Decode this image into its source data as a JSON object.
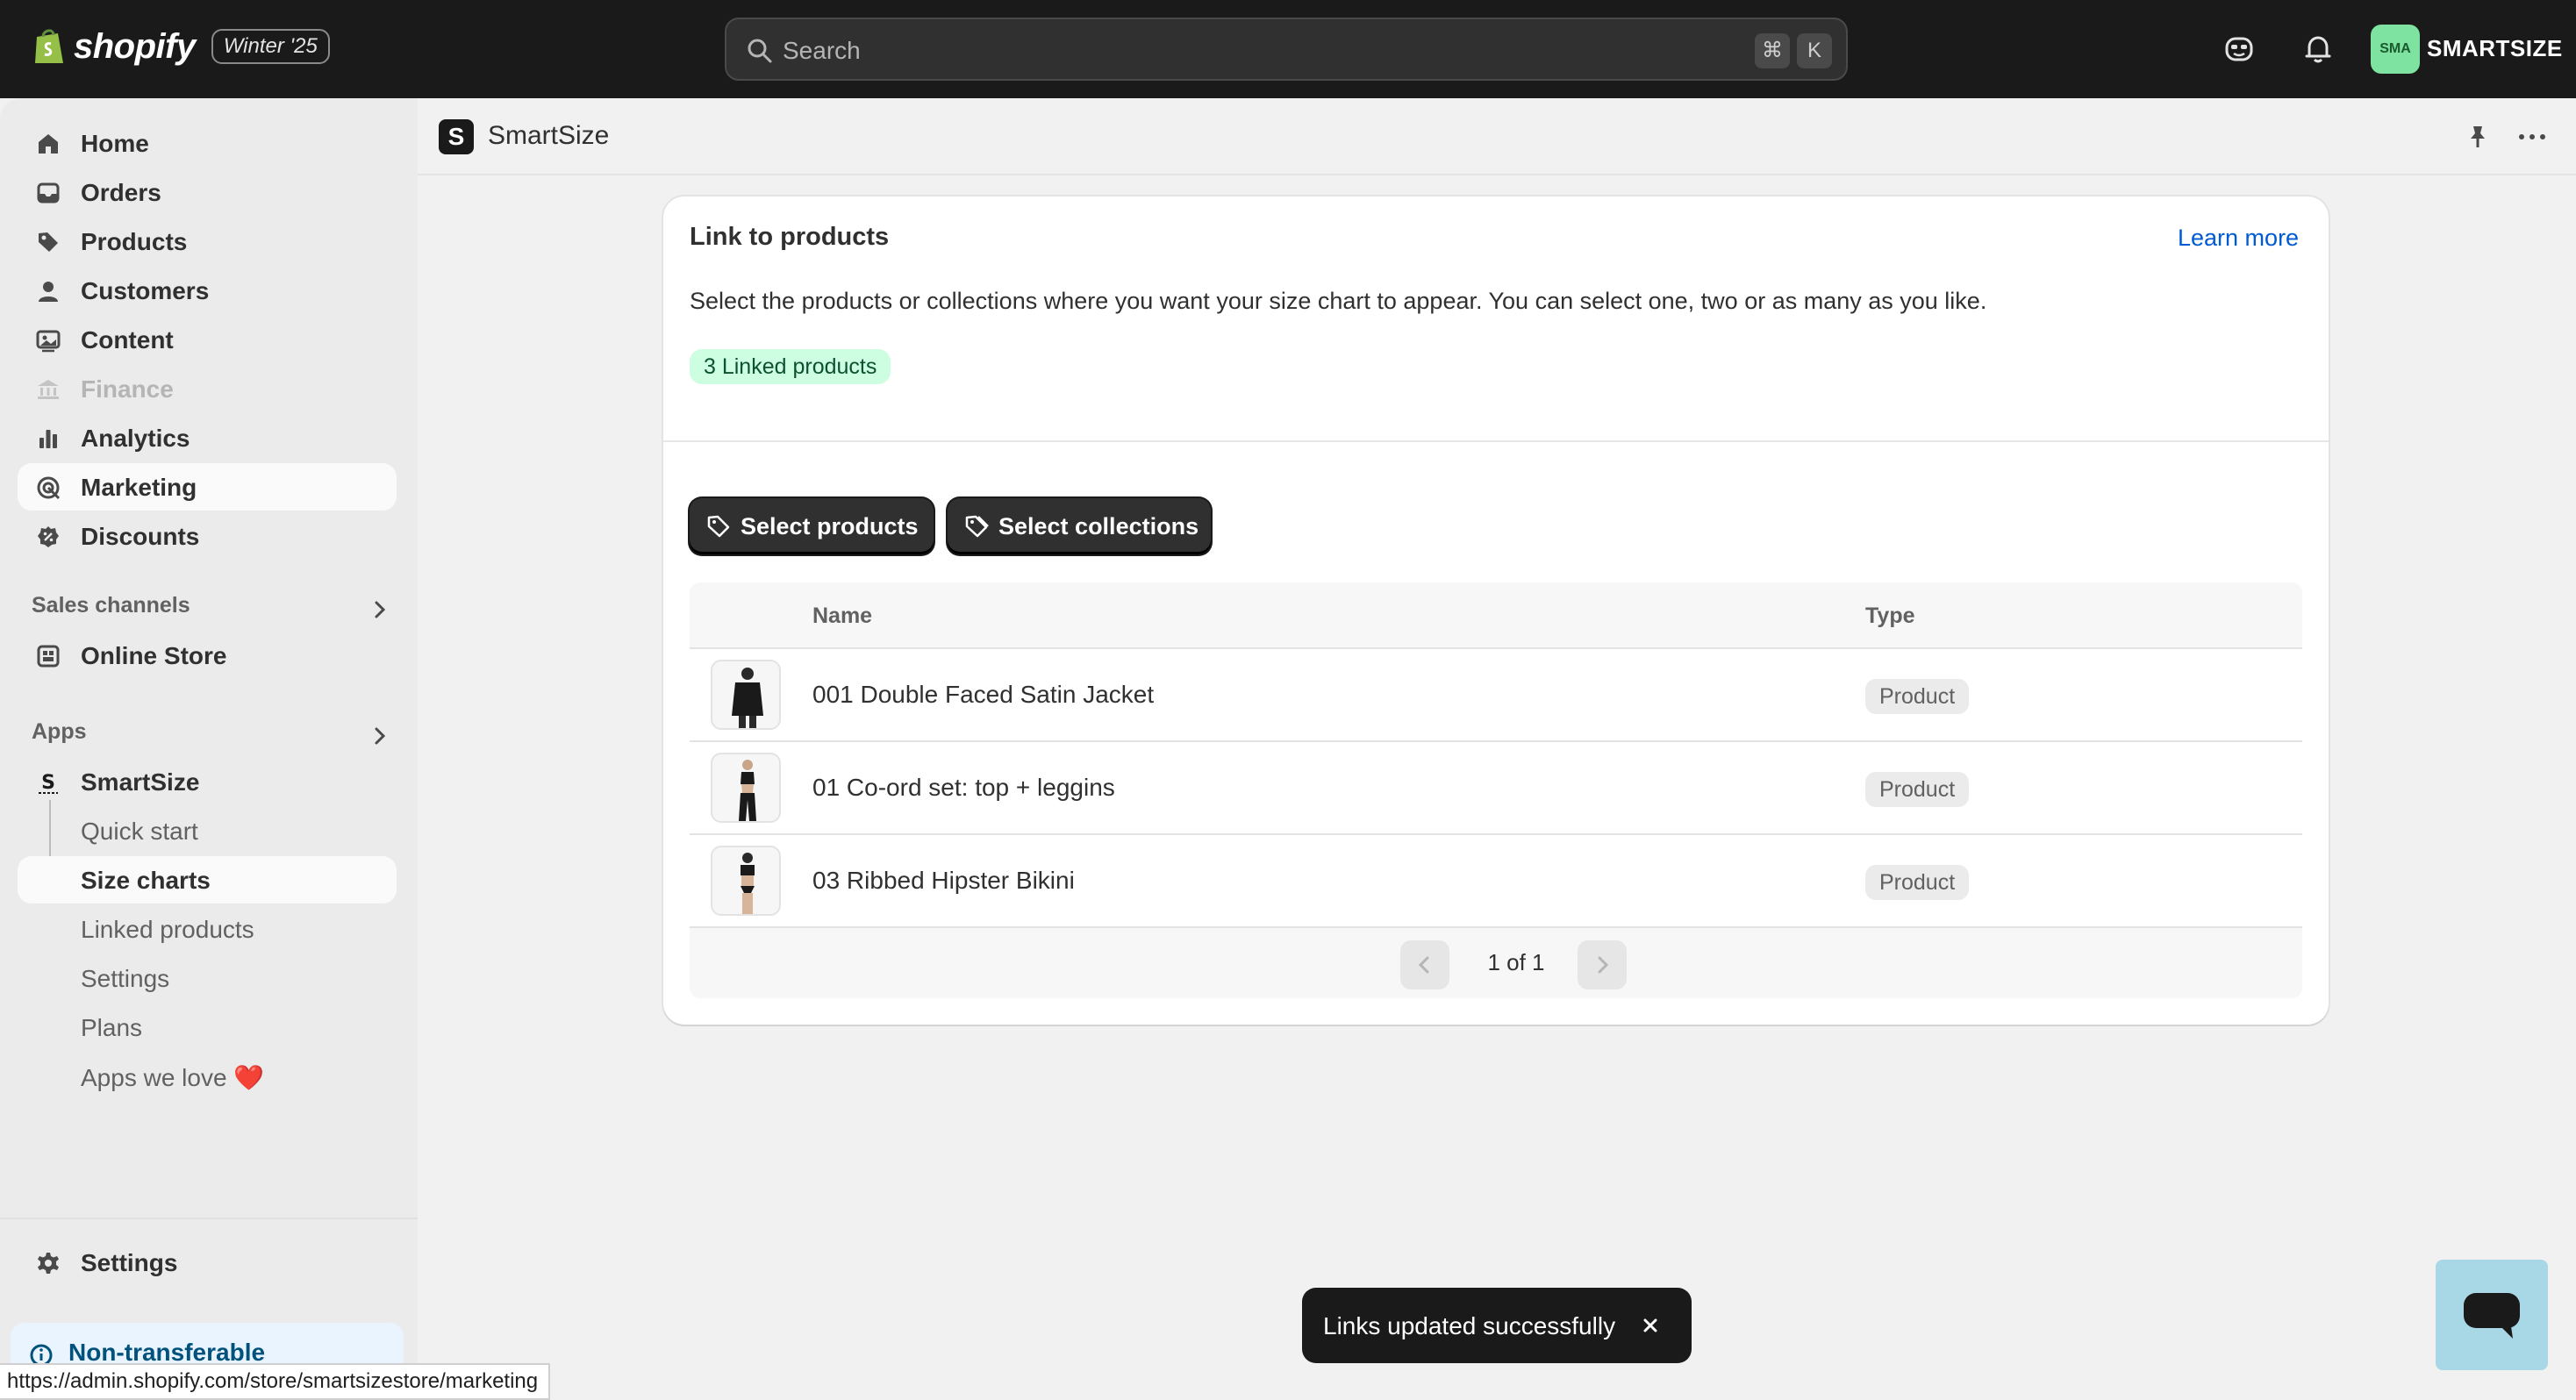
{
  "topbar": {
    "brand": "shopify",
    "edition": "Winter '25",
    "search_placeholder": "Search",
    "shortcut_cmd": "⌘",
    "shortcut_key": "K",
    "avatar_initials": "SMA",
    "store_name": "SMARTSIZE"
  },
  "sidebar": {
    "main": [
      {
        "label": "Home",
        "icon": "home-icon"
      },
      {
        "label": "Orders",
        "icon": "inbox-icon"
      },
      {
        "label": "Products",
        "icon": "tag-icon"
      },
      {
        "label": "Customers",
        "icon": "person-icon"
      },
      {
        "label": "Content",
        "icon": "content-icon"
      },
      {
        "label": "Finance",
        "icon": "bank-icon"
      },
      {
        "label": "Analytics",
        "icon": "bar-chart-icon"
      },
      {
        "label": "Marketing",
        "icon": "target-icon"
      },
      {
        "label": "Discounts",
        "icon": "discount-icon"
      }
    ],
    "sales_channels_label": "Sales channels",
    "online_store_label": "Online Store",
    "apps_label": "Apps",
    "app_name": "SmartSize",
    "app_sub": [
      "Quick start",
      "Size charts",
      "Linked products",
      "Settings",
      "Plans",
      "Apps we love ❤️"
    ],
    "settings_label": "Settings",
    "nontransferable_label": "Non-transferable"
  },
  "status_url": "https://admin.shopify.com/store/smartsizestore/marketing",
  "app_header": {
    "logo_letter": "S",
    "title": "SmartSize"
  },
  "card": {
    "title": "Link to products",
    "learn_more": "Learn more",
    "description": "Select the products or collections where you want your size chart to appear. You can select one, two or as many as you like.",
    "badge": "3 Linked products",
    "select_products": "Select products",
    "select_collections": "Select collections",
    "columns": {
      "name": "Name",
      "type": "Type"
    },
    "rows": [
      {
        "name": "001 Double Faced Satin Jacket",
        "type": "Product"
      },
      {
        "name": "01 Co-ord set: top + leggins",
        "type": "Product"
      },
      {
        "name": "03 Ribbed Hipster Bikini",
        "type": "Product"
      }
    ],
    "pagination": "1 of 1"
  },
  "toast": {
    "message": "Links updated successfully"
  },
  "colors": {
    "topbar": "#1a1a1a",
    "accent_link": "#005bd3",
    "badge_bg": "#cdfee1",
    "avatar_bg": "#7ee2a0"
  }
}
